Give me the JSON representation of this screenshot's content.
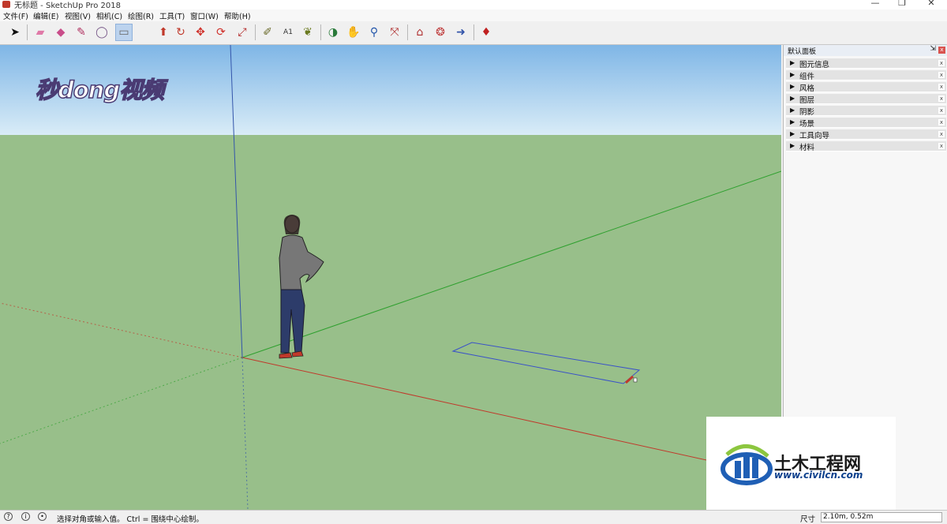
{
  "window": {
    "title": "无标题 - SketchUp Pro 2018",
    "minimize": "—",
    "maximize": "❐",
    "close": "✕"
  },
  "menu": [
    "文件(F)",
    "编辑(E)",
    "视图(V)",
    "相机(C)",
    "绘图(R)",
    "工具(T)",
    "窗口(W)",
    "帮助(H)"
  ],
  "toolbar": {
    "icons": [
      "select-icon",
      "eraser-icon",
      "paint-bucket-icon",
      "line-icon",
      "rectangle-icon",
      "circle-icon",
      "pushpull-icon",
      "move-icon",
      "rotate-icon",
      "scale-icon",
      "tape-measure-icon",
      "text-icon",
      "paint-icon",
      "orbit-icon",
      "pan-icon",
      "zoom-icon",
      "zoom-extents-icon",
      "warehouse-icon",
      "extension-icon",
      "share-icon",
      "ruby-icon"
    ],
    "active": "rectangle-icon"
  },
  "overlay_logo": "秒dong视频",
  "panel": {
    "title": "默认面板",
    "pin": "⇲",
    "close": "x",
    "trays": [
      "图元信息",
      "组件",
      "风格",
      "图层",
      "阴影",
      "场景",
      "工具向导",
      "材料"
    ]
  },
  "statusbar": {
    "message": "选择对角或输入值。 Ctrl = 围绕中心绘制。",
    "dimension_label": "尺寸",
    "dimension_value": "2.10m, 0.52m"
  },
  "watermark": {
    "title": "土木工程网",
    "url": "www.civilcn.com"
  },
  "colors": {
    "sky_top": "#7fb6e6",
    "ground": "#98bf8a",
    "axis_red": "#c0392b",
    "axis_green": "#2fa02f",
    "axis_blue": "#3355aa",
    "rectangle": "#3a52c8"
  }
}
